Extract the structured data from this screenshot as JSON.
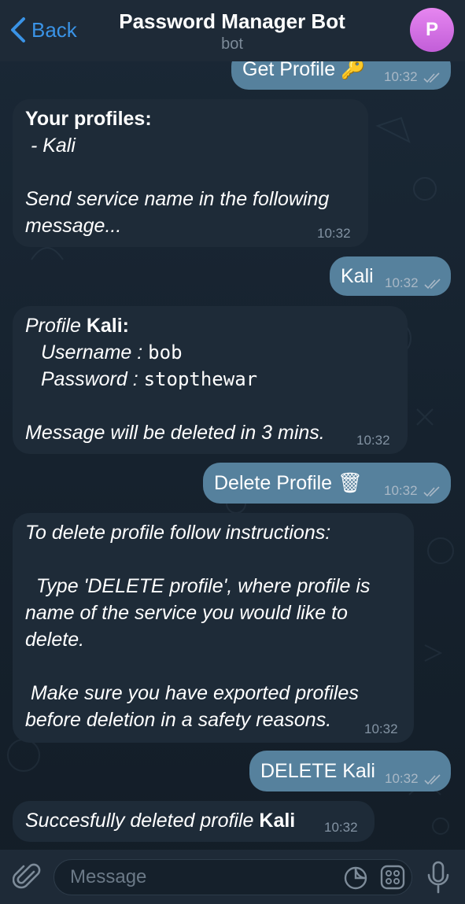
{
  "header": {
    "back_label": "Back",
    "title": "Password Manager Bot",
    "subtitle": "bot",
    "avatar_letter": "P",
    "avatar_color": "#d070e6"
  },
  "messages": [
    {
      "dir": "out",
      "text": "Get Profile",
      "emoji": "🔑",
      "time": "10:32"
    },
    {
      "dir": "in",
      "heading": "Your profiles:",
      "line1": " - Kali",
      "line2": "Send service name in the following",
      "line3": "message...",
      "time": "10:32"
    },
    {
      "dir": "out",
      "text": "Kali",
      "time": "10:32"
    },
    {
      "dir": "in",
      "prefix": "Profile ",
      "name": "Kali:",
      "username_label": "Username : ",
      "username_value": "bob",
      "password_label": "Password : ",
      "password_value": "stopthewar",
      "note": "Message will be deleted in 3 mins.",
      "time": "10:32"
    },
    {
      "dir": "out",
      "text": "Delete Profile",
      "emoji": "🗑",
      "time": "10:32"
    },
    {
      "dir": "in",
      "lines": [
        "To delete profile follow instructions:",
        "",
        "  Type 'DELETE profile', where profile is",
        "name of the service you would like to",
        "delete.",
        "",
        " Make sure you have exported profiles",
        "before deletion in a safety reasons."
      ],
      "time": "10:32"
    },
    {
      "dir": "out",
      "text": "DELETE Kali",
      "time": "10:32"
    },
    {
      "dir": "in",
      "prefix": "Succesfully deleted profile ",
      "name": "Kali",
      "time": "10:32"
    }
  ],
  "input": {
    "placeholder": "Message"
  },
  "colors": {
    "outgoing_bubble": "#56819d",
    "incoming_bubble": "#1e2b38",
    "accent": "#3a93e6"
  }
}
